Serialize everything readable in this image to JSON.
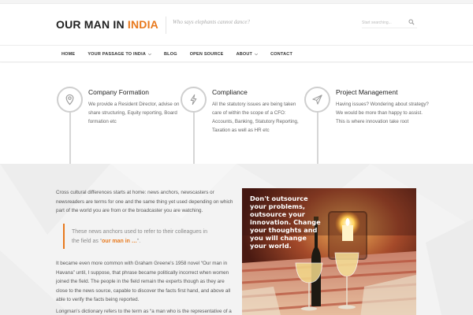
{
  "header": {
    "logo_main": "OUR MAN IN ",
    "logo_accent": "INDIA",
    "tagline": "Who says elephants cannot dance?",
    "search_placeholder": "Start searching...",
    "search_icon": "search-icon"
  },
  "nav": {
    "items": [
      {
        "label": "HOME",
        "has_dropdown": false
      },
      {
        "label": "YOUR PASSAGE TO INDIA",
        "has_dropdown": true
      },
      {
        "label": "BLOG",
        "has_dropdown": false
      },
      {
        "label": "OPEN SOURCE",
        "has_dropdown": false
      },
      {
        "label": "ABOUT",
        "has_dropdown": true
      },
      {
        "label": "CONTACT",
        "has_dropdown": false
      }
    ]
  },
  "features": [
    {
      "icon": "map-pin-icon",
      "title": "Company Formation",
      "body": "We provide a Resident Director, advise on share structuring, Equity reporting, Board formation etc"
    },
    {
      "icon": "lightning-icon",
      "title": "Compliance",
      "body": "All the statutory issues are being taken care of within the scope of a CFO: Accounts, Banking, Statutory Reporting, Taxation as well as HR etc"
    },
    {
      "icon": "send-icon",
      "title": "Project Management",
      "body": "Having issues? Wondering about strategy? We would be more than happy to assist. This is where innovation take root"
    }
  ],
  "article": {
    "p1": "Cross cultural differences starts at home: news anchors, newscasters or newsreaders are terms for one and the same thing yet used depending on which part of the world you are from or the broadcaster you are watching.",
    "quote_text": "These news anchors used to refer to their colleagues in the field as “",
    "quote_highlight": "our man in …",
    "quote_end": "”.",
    "p2": "It became even more common with Graham Greene's 1958 novel “Our man in Havana” until, I suppose, that phrase became politically incorrect when women joined the field. The people in the field remain the experts though as they are close to the news source, capable to discover the facts first hand, and above all able to verify the facts being reported.",
    "p3": "Longman's dictionary refers to the term as “a man who is the representative of a"
  },
  "photo": {
    "overlay_text": "Don't outsource your problems, outsource your innovation. Change your thoughts and you will change your world."
  },
  "colors": {
    "accent": "#e8791d",
    "text": "#555555",
    "content_bg": "#f3f3f3"
  }
}
